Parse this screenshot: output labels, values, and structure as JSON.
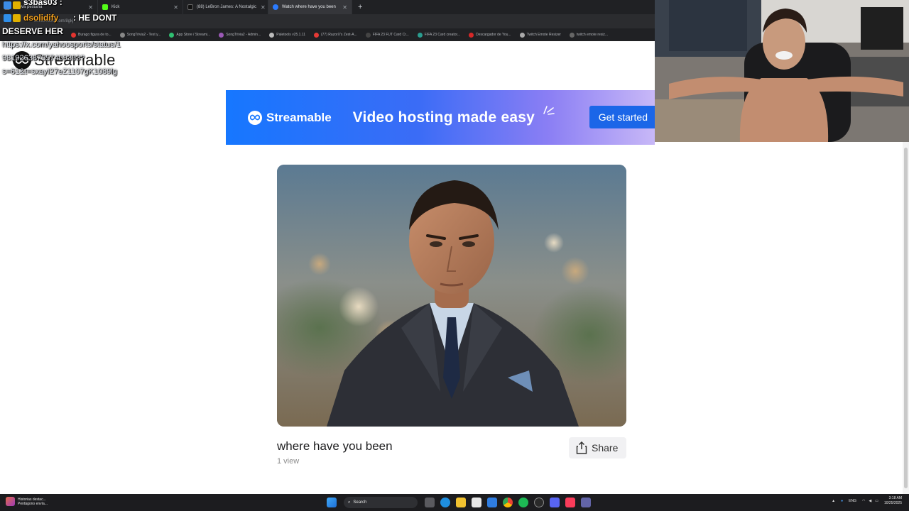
{
  "browser": {
    "tabs": [
      {
        "label": "Nueva pestaña",
        "active": false
      },
      {
        "label": "Kick",
        "active": false
      },
      {
        "label": "(88) LeBron James: A Nostalgic",
        "active": false
      },
      {
        "label": "Watch where have you been",
        "active": true
      }
    ],
    "url": "streamable.com/8gkj",
    "bookmarks": [
      "Burago figura de to...",
      "SongTrivia2 - Test y...",
      "App Store / Streami...",
      "SongTrivia2 - Admin...",
      "Paletools v25.1.11",
      "(77) RazorX's Zest-A...",
      "FIFA 23 FUT Card Cr...",
      "FIFA 23 Card creator...",
      "Descargador de You...",
      "Twitch Emote Resizer",
      "twitch emote resiz..."
    ]
  },
  "chat": {
    "user1": "s3bas03 :",
    "user2": "dsolidify",
    "message2": ": HE DONT",
    "message2_cont": "DESERVE HER",
    "link_line1": "https://x.com/yahoosports/status/1",
    "link_line2": "981926387557409393?",
    "link_line3": "s=61&t=sxayI27eZ1107gK1089lg"
  },
  "page": {
    "logo_text": "Streamable",
    "banner": {
      "brand": "Streamable",
      "tagline": "Video hosting made easy",
      "cta": "Get started"
    },
    "video": {
      "title": "where have you been",
      "views": "1 view"
    },
    "share_label": "Share"
  },
  "taskbar": {
    "widget_title": "Historias destac...",
    "widget_sub": "Pentágono envía...",
    "search_label": "Search",
    "lang": "ENG",
    "time": "3:18 AM",
    "date": "10/25/2025"
  },
  "colors": {
    "banner_start": "#1677ff",
    "banner_end": "#c8b8f7",
    "cta_bg": "#1b66e8",
    "chat_orange": "#f4a21f"
  }
}
